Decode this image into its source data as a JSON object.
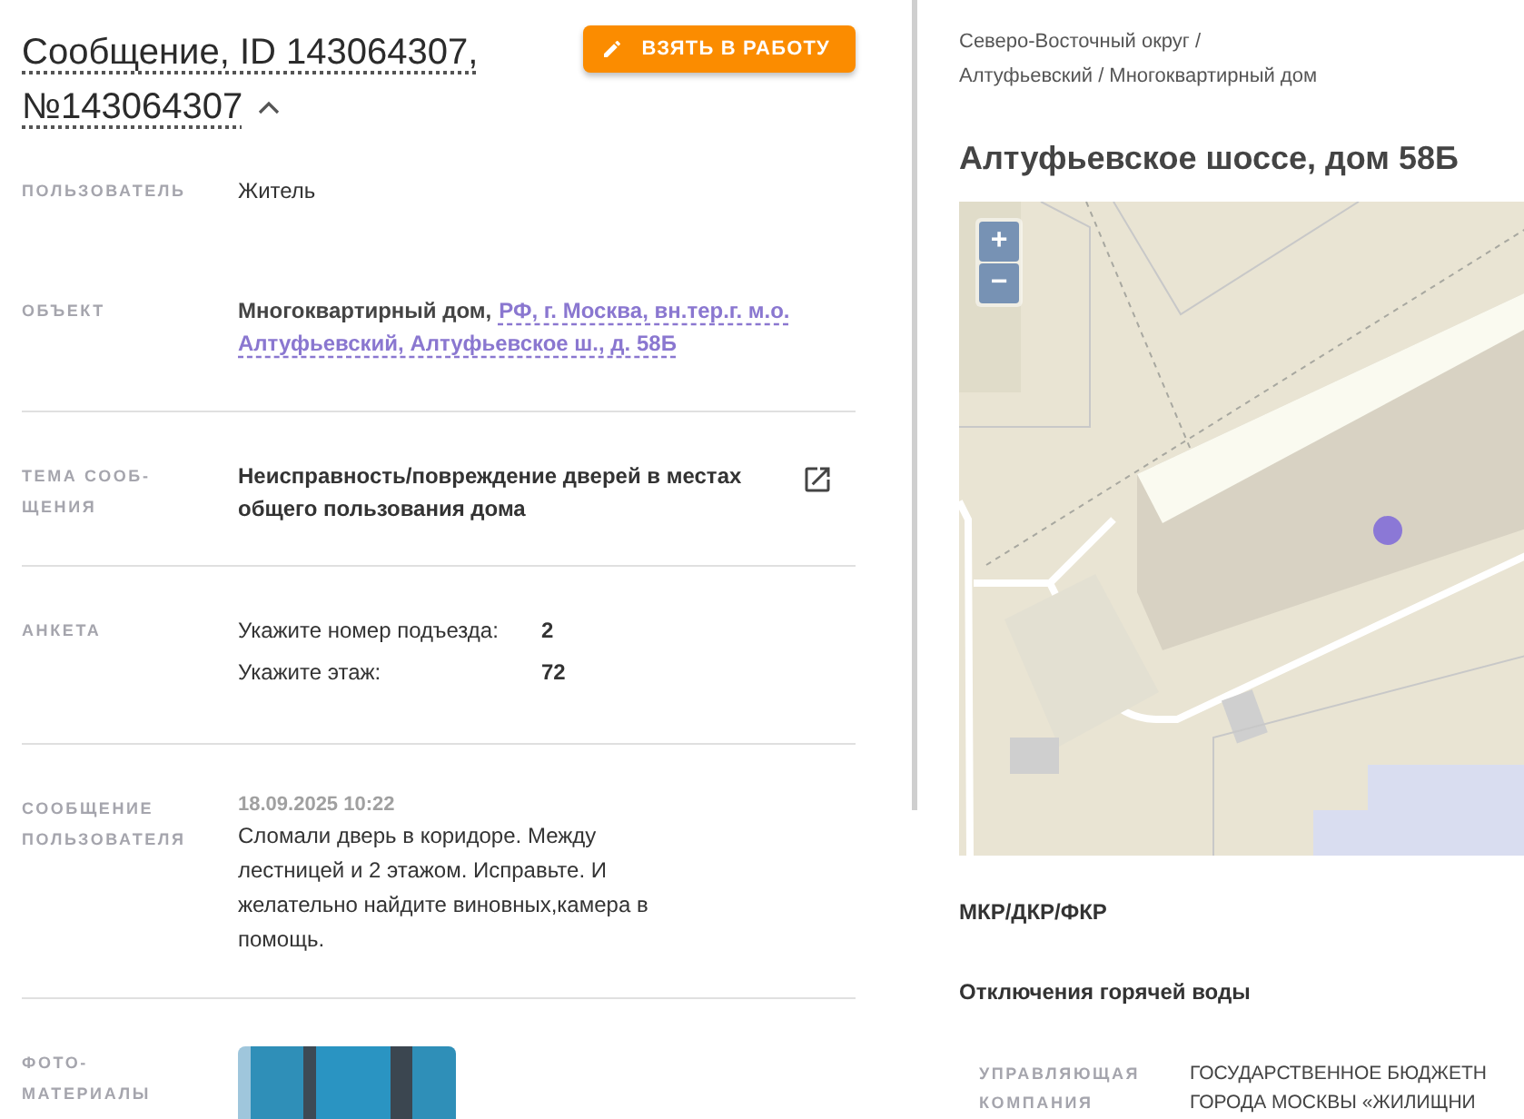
{
  "message": {
    "title_line1": "Сообщение, ID 143064307,",
    "title_line2": "№143064307",
    "expanded": true,
    "take_button": "ВЗЯТЬ В РАБОТУ",
    "sections": [
      {
        "kind": "text",
        "label": "ПОЛЬЗОВАТЕЛЬ",
        "value": "Житель"
      },
      {
        "kind": "object",
        "label": "ОБЪЕКТ",
        "prefix": "Многоквартирный дом,",
        "link_lines": [
          "РФ, г. Москва, вн.тер.г. м.о.",
          "Алтуфьевский, Алтуфьевское ш., д. 58Б"
        ]
      },
      {
        "kind": "topic",
        "label": "ТЕМА СООБ-ЩЕНИЯ",
        "value": "Неисправность/повреждение дверей в местах общего пользования дома"
      },
      {
        "kind": "form",
        "label": "АНКЕТА",
        "rows": [
          {
            "question": "Укажите номер подъезда:",
            "answer": "2"
          },
          {
            "question": "Укажите этаж:",
            "answer": "72"
          }
        ]
      },
      {
        "kind": "message",
        "label": "СООБЩЕНИЕ ПОЛЬЗОВАТЕЛЯ",
        "date": "18.09.2025 10:22",
        "value": "Сломали дверь в коридоре. Между лестницей и 2 этажом. Исправьте. И желательно найдите виновных,камера в помощь."
      },
      {
        "kind": "photos",
        "label": "ФОТО-МАТЕРИАЛЫ"
      }
    ]
  },
  "building": {
    "breadcrumb_line1": "Северо-Восточный округ /",
    "breadcrumb_line2": "Алтуфьевский / Многоквартирный дом",
    "title": "Алтуфьевское шоссе, дом 58Б",
    "map": {
      "zoom_in": "+",
      "zoom_out": "−"
    },
    "links": [
      "МКР/ДКР/ФКР",
      "Отключения горячей воды"
    ],
    "management": {
      "label": "УПРАВЛЯЮЩАЯ КОМПАНИЯ",
      "line1": "ГОСУДАРСТВЕННОЕ БЮДЖЕТН",
      "line2": "ГОРОДА МОСКВЫ «ЖИЛИЩНИ"
    }
  }
}
